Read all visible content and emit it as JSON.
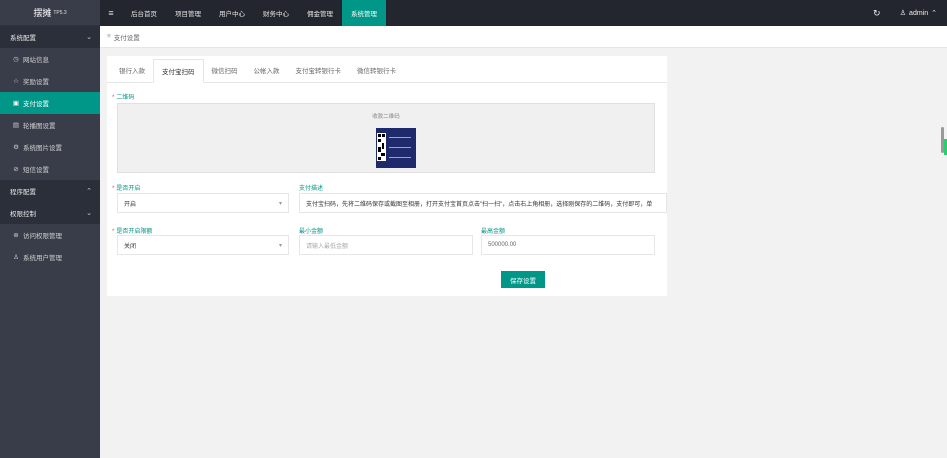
{
  "sidebar": {
    "logo": "摆摊",
    "version": "TP5.3",
    "groups": [
      {
        "label": "系统配置",
        "items": [
          {
            "icon": "clock-icon",
            "glyph": "◷",
            "label": "网站信息"
          },
          {
            "icon": "star-icon",
            "glyph": "☆",
            "label": "奖励设置"
          },
          {
            "icon": "card-icon",
            "glyph": "▣",
            "label": "支付设置",
            "active": true
          },
          {
            "icon": "image-icon",
            "glyph": "▤",
            "label": "轮播图设置"
          },
          {
            "icon": "gear-icon",
            "glyph": "⚙",
            "label": "系统图片设置"
          },
          {
            "icon": "link-icon",
            "glyph": "⊘",
            "label": "短信设置"
          }
        ]
      },
      {
        "label": "程序配置",
        "collapsed": true
      },
      {
        "label": "权限控制",
        "items": [
          {
            "icon": "shield-icon",
            "glyph": "⊛",
            "label": "访问权限管理"
          },
          {
            "icon": "user-icon",
            "glyph": "♙",
            "label": "系统用户管理"
          }
        ]
      }
    ]
  },
  "topbar": {
    "menu": [
      "后台首页",
      "项目管理",
      "用户中心",
      "财务中心",
      "佣金管理",
      "系统管理"
    ],
    "active_index": 5,
    "user": "admin"
  },
  "breadcrumb": "支付设置",
  "tabs": [
    "银行入款",
    "支付宝扫码",
    "微信扫码",
    "公帐入款",
    "支付宝转银行卡",
    "微信转银行卡"
  ],
  "active_tab": 1,
  "form": {
    "qr_label": "二维码",
    "qr_caption": "收款二维码",
    "enable_label": "是否开启",
    "enable_value": "开启",
    "desc_label": "支付描述",
    "desc_value": "支付宝扫码，先将二维码保存或截图至相册，打开支付宝首页点击\"扫一扫\"，点击右上角相册，选择刚保存的二维码，支付即可，单",
    "limit_label": "是否开启限额",
    "limit_value": "关闭",
    "min_label": "最小金额",
    "min_placeholder": "请输入最低金额",
    "max_label": "最高金额",
    "max_value": "500000.00",
    "save": "保存设置"
  },
  "colors": {
    "accent": "#009688",
    "sidebar": "#393d49",
    "topbar": "#23262e"
  }
}
